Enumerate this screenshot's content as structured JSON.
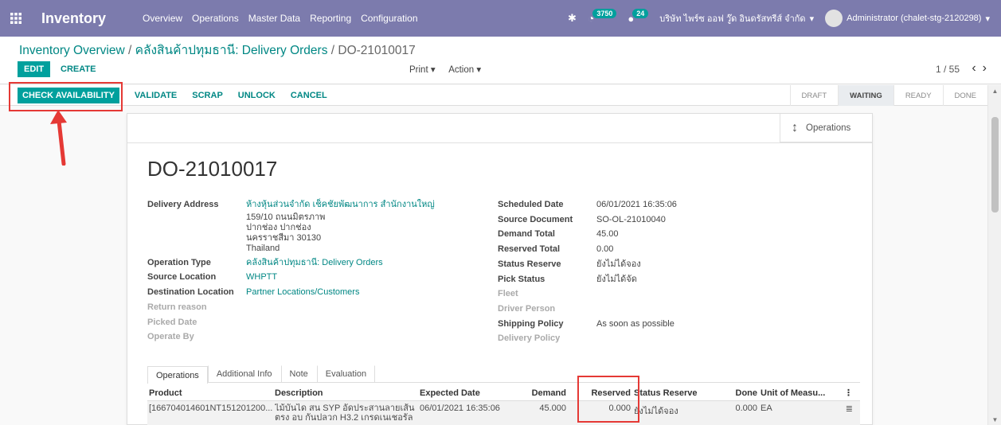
{
  "navbar": {
    "app_name": "Inventory",
    "menu": [
      "Overview",
      "Operations",
      "Master Data",
      "Reporting",
      "Configuration"
    ],
    "activity_count": "3750",
    "message_count": "24",
    "company": "บริษัท ไพร์ซ ออฟ วู๊ด อินดรัสทรีส์ จำกัด",
    "user": "Administrator (chalet-stg-2120298)",
    "bg_color": "#7c7bad"
  },
  "control_panel": {
    "breadcrumb_root": "Inventory Overview",
    "breadcrumb_sep1": " / ",
    "breadcrumb_mid": "คลังสินค้าปทุมธานี: Delivery Orders",
    "breadcrumb_sep2": " / ",
    "breadcrumb_current": "DO-21010017",
    "edit_label": "EDIT",
    "create_label": "CREATE",
    "print_label": "Print ▾",
    "action_label": "Action ▾",
    "pager": "1 / 55"
  },
  "status_bar": {
    "check_availability": "CHECK AVAILABILITY",
    "validate": "VALIDATE",
    "scrap": "SCRAP",
    "unlock": "UNLOCK",
    "cancel": "CANCEL",
    "stages": [
      "DRAFT",
      "WAITING",
      "READY",
      "DONE"
    ],
    "active_stage": "WAITING"
  },
  "sheet": {
    "operations_button": "Operations",
    "record_name": "DO-21010017",
    "left_fields": {
      "delivery_address_label": "Delivery Address",
      "delivery_address_name": "ห้างหุ้นส่วนจำกัด เช็คชัยพัฒนาการ สำนักงานใหญ่",
      "delivery_address_line1": "159/10 ถนนมิตรภาพ",
      "delivery_address_line2": "ปากช่อง ปากช่อง",
      "delivery_address_line3": "นครราชสีมา 30130",
      "delivery_address_line4": "Thailand",
      "operation_type_label": "Operation Type",
      "operation_type": "คลังสินค้าปทุมธานี: Delivery Orders",
      "source_location_label": "Source Location",
      "source_location": "WHPTT",
      "destination_location_label": "Destination Location",
      "destination_location": "Partner Locations/Customers",
      "return_reason_label": "Return reason",
      "picked_date_label": "Picked Date",
      "operate_by_label": "Operate By"
    },
    "right_fields": {
      "scheduled_date_label": "Scheduled Date",
      "scheduled_date": "06/01/2021 16:35:06",
      "source_document_label": "Source Document",
      "source_document": "SO-OL-21010040",
      "demand_total_label": "Demand Total",
      "demand_total": "45.00",
      "reserved_total_label": "Reserved Total",
      "reserved_total": "0.00",
      "status_reserve_label": "Status Reserve",
      "status_reserve": "ยังไม่ได้จอง",
      "pick_status_label": "Pick Status",
      "pick_status": "ยังไม่ได้จัด",
      "fleet_label": "Fleet",
      "driver_person_label": "Driver Person",
      "shipping_policy_label": "Shipping Policy",
      "shipping_policy": "As soon as possible",
      "delivery_policy_label": "Delivery Policy"
    },
    "tabs": [
      "Operations",
      "Additional Info",
      "Note",
      "Evaluation"
    ],
    "table": {
      "headers": [
        "Product",
        "Description",
        "Expected Date",
        "Demand",
        "Reserved",
        "Status Reserve",
        "Done",
        "Unit of Measu...",
        "⋮"
      ],
      "rows": [
        {
          "product": "[166704014601NT151201200...",
          "description": "ไม้บันได สน SYP อัดประสานลายเส้นตรง อบ กันปลวก H3.2 เกรดเนเชอรัล",
          "expected_date": "06/01/2021 16:35:06",
          "demand": "45.000",
          "reserved": "0.000",
          "status_reserve": "ยังไม่ได้จอง",
          "done": "0.000",
          "uom": "EA",
          "detail_icon": "≣"
        }
      ]
    }
  }
}
